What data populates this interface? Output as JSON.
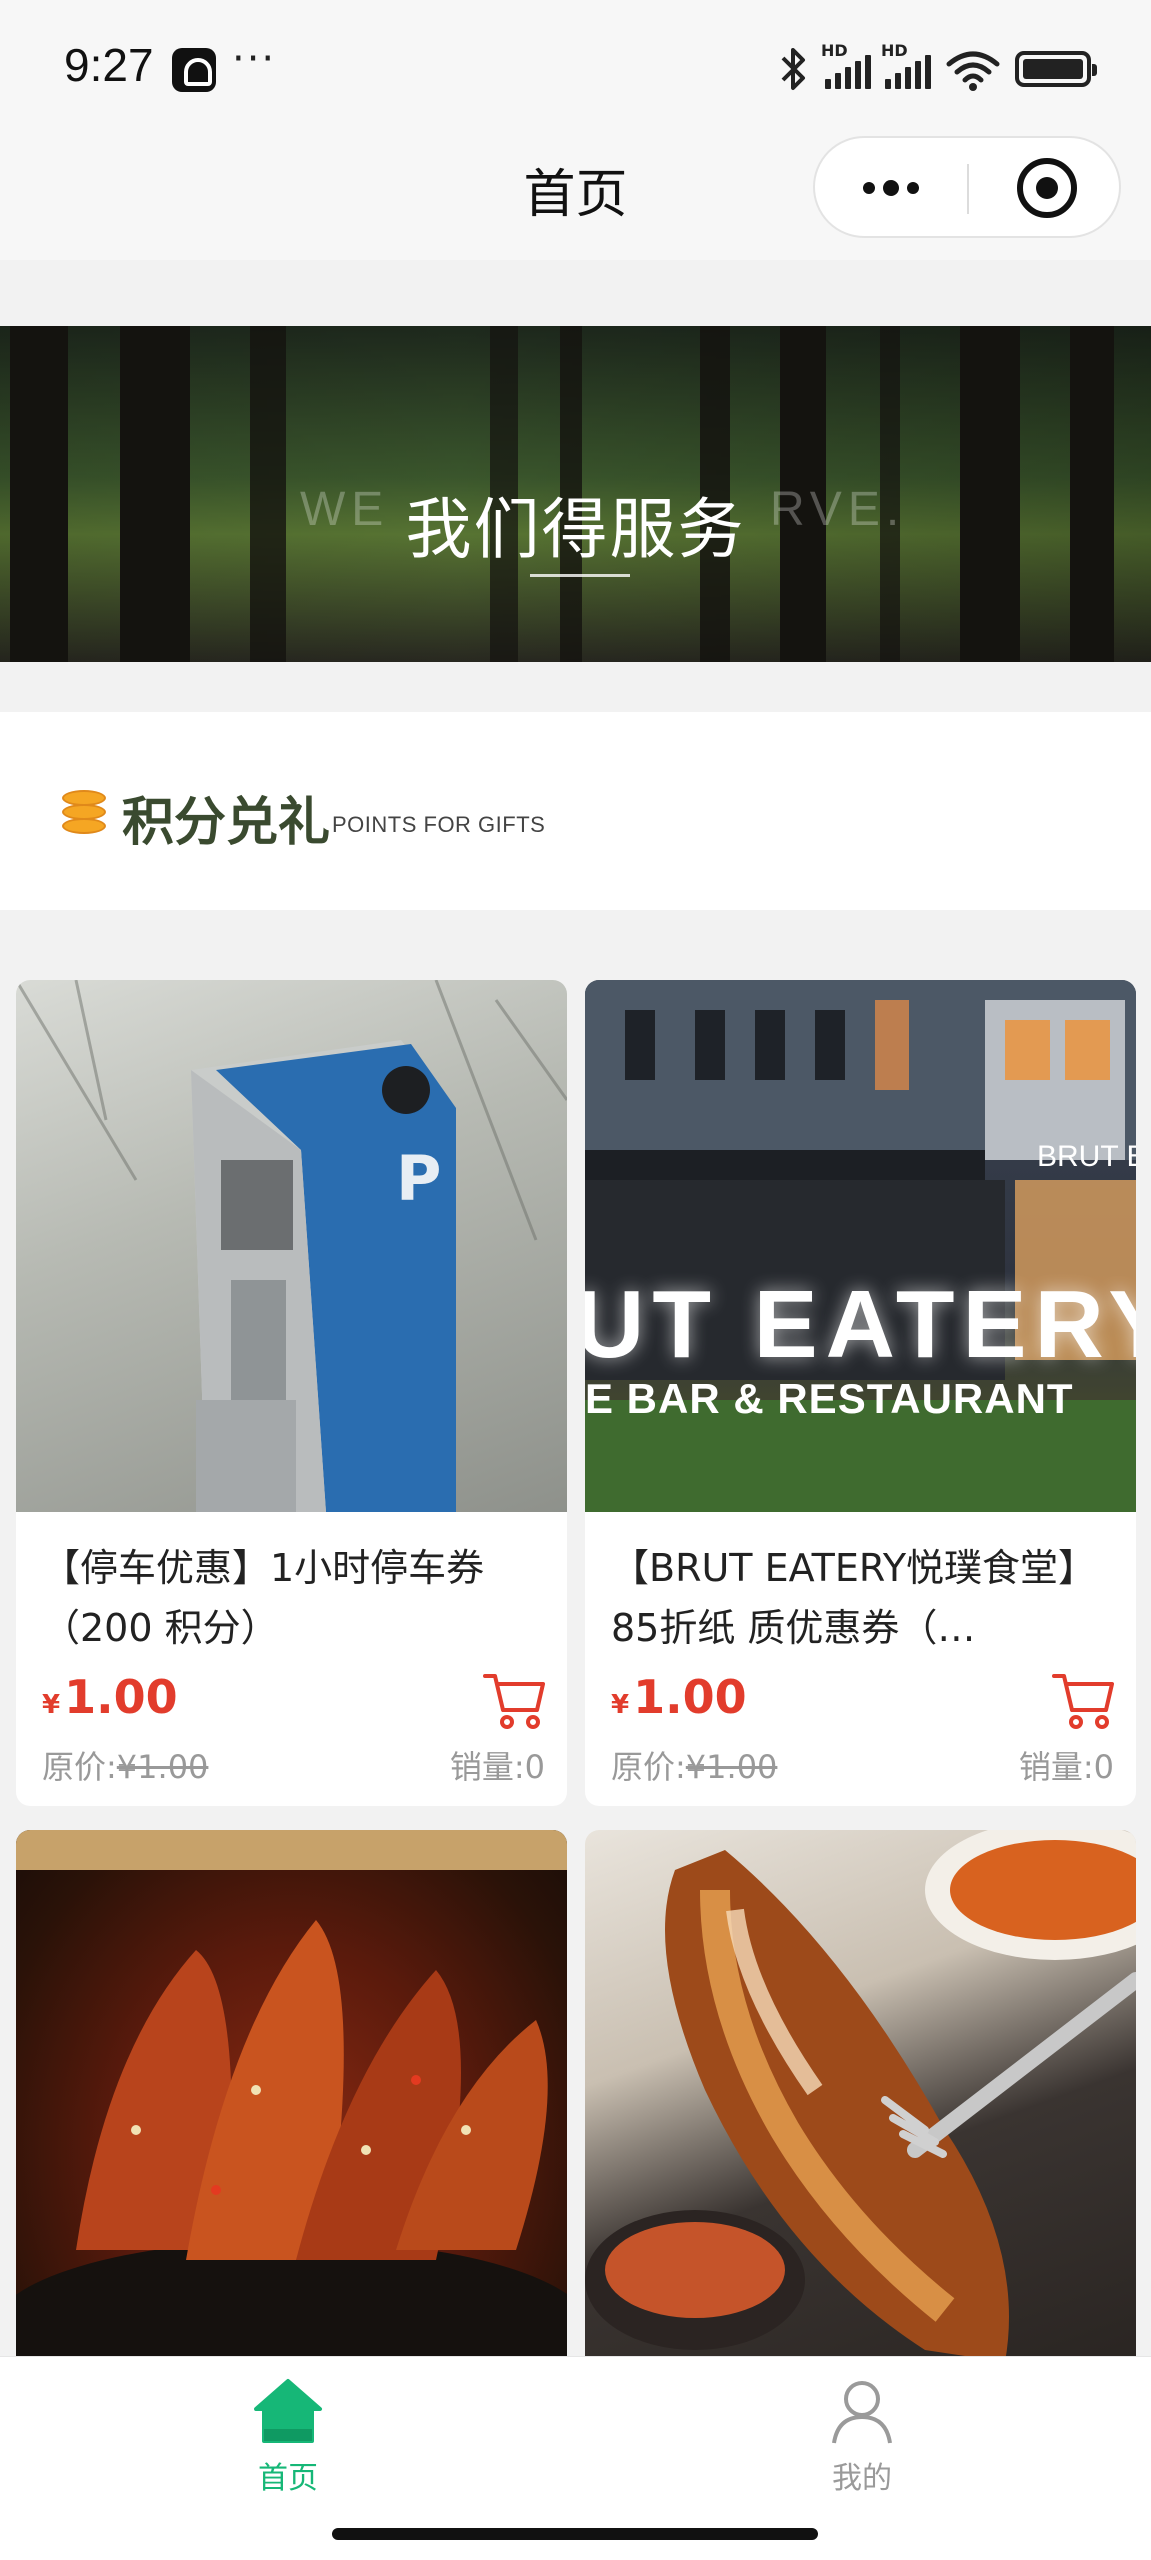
{
  "status_bar": {
    "time": "9:27",
    "more": "···",
    "hd_label": "HD"
  },
  "nav": {
    "title": "首页"
  },
  "banner": {
    "title": "我们得服务",
    "ghost_left": "WE",
    "ghost_right": "RVE."
  },
  "section": {
    "title": "积分兑礼",
    "subtitle": "POINTS FOR GIFTS"
  },
  "products": [
    {
      "name": "【停车优惠】1小时停车券（200 积分）",
      "currency": "¥",
      "price": "1.00",
      "original_label": "原价:",
      "original_price": "¥1.00",
      "sales": "销量:0",
      "image": "parking-meter"
    },
    {
      "name": "【BRUT EATERY悦璞食堂】 85折纸 质优惠券（…",
      "currency": "¥",
      "price": "1.00",
      "original_label": "原价:",
      "original_price": "¥1.00",
      "sales": "销量:0",
      "image": "restaurant-storefront",
      "image_sign_1": "UT EATERY",
      "image_sign_2": "E BAR & RESTAURANT",
      "image_sign_3": "BRUT E"
    },
    {
      "image": "braised-duck-tongue"
    },
    {
      "image": "grilled-fish"
    }
  ],
  "tabs": [
    {
      "label": "首页",
      "icon": "home-icon",
      "active": true
    },
    {
      "label": "我的",
      "icon": "user-icon",
      "active": false
    }
  ],
  "colors": {
    "accent_green": "#16b777",
    "price_red": "#e23c2c",
    "muted_gray": "#999999"
  }
}
